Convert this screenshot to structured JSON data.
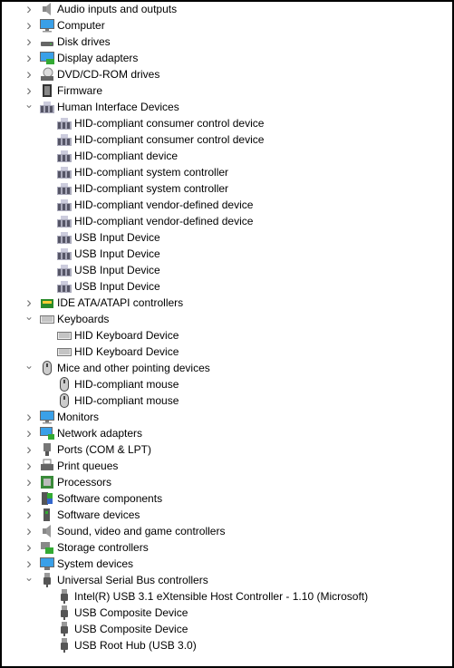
{
  "tree": [
    {
      "label": "Audio inputs and outputs",
      "level": 1,
      "expanded": false,
      "icon": "speaker-icon"
    },
    {
      "label": "Computer",
      "level": 1,
      "expanded": false,
      "icon": "monitor-icon"
    },
    {
      "label": "Disk drives",
      "level": 1,
      "expanded": false,
      "icon": "disk-drive-icon"
    },
    {
      "label": "Display adapters",
      "level": 1,
      "expanded": false,
      "icon": "display-adapter-icon"
    },
    {
      "label": "DVD/CD-ROM drives",
      "level": 1,
      "expanded": false,
      "icon": "dvd-drive-icon"
    },
    {
      "label": "Firmware",
      "level": 1,
      "expanded": false,
      "icon": "chip-icon"
    },
    {
      "label": "Human Interface Devices",
      "level": 1,
      "expanded": true,
      "icon": "hid-icon"
    },
    {
      "label": "HID-compliant consumer control device",
      "level": 2,
      "icon": "hid-icon"
    },
    {
      "label": "HID-compliant consumer control device",
      "level": 2,
      "icon": "hid-icon"
    },
    {
      "label": "HID-compliant device",
      "level": 2,
      "icon": "hid-icon"
    },
    {
      "label": "HID-compliant system controller",
      "level": 2,
      "icon": "hid-icon"
    },
    {
      "label": "HID-compliant system controller",
      "level": 2,
      "icon": "hid-icon"
    },
    {
      "label": "HID-compliant vendor-defined device",
      "level": 2,
      "icon": "hid-icon"
    },
    {
      "label": "HID-compliant vendor-defined device",
      "level": 2,
      "icon": "hid-icon"
    },
    {
      "label": "USB Input Device",
      "level": 2,
      "icon": "hid-icon"
    },
    {
      "label": "USB Input Device",
      "level": 2,
      "icon": "hid-icon"
    },
    {
      "label": "USB Input Device",
      "level": 2,
      "icon": "hid-icon"
    },
    {
      "label": "USB Input Device",
      "level": 2,
      "icon": "hid-icon"
    },
    {
      "label": "IDE ATA/ATAPI controllers",
      "level": 1,
      "expanded": false,
      "icon": "ide-controller-icon"
    },
    {
      "label": "Keyboards",
      "level": 1,
      "expanded": true,
      "icon": "keyboard-icon"
    },
    {
      "label": "HID Keyboard Device",
      "level": 2,
      "icon": "keyboard-icon"
    },
    {
      "label": "HID Keyboard Device",
      "level": 2,
      "icon": "keyboard-icon"
    },
    {
      "label": "Mice and other pointing devices",
      "level": 1,
      "expanded": true,
      "icon": "mouse-icon"
    },
    {
      "label": "HID-compliant mouse",
      "level": 2,
      "icon": "mouse-icon"
    },
    {
      "label": "HID-compliant mouse",
      "level": 2,
      "icon": "mouse-icon"
    },
    {
      "label": "Monitors",
      "level": 1,
      "expanded": false,
      "icon": "monitor-icon"
    },
    {
      "label": "Network adapters",
      "level": 1,
      "expanded": false,
      "icon": "network-adapter-icon"
    },
    {
      "label": "Ports (COM & LPT)",
      "level": 1,
      "expanded": false,
      "icon": "port-icon"
    },
    {
      "label": "Print queues",
      "level": 1,
      "expanded": false,
      "icon": "printer-icon"
    },
    {
      "label": "Processors",
      "level": 1,
      "expanded": false,
      "icon": "processor-icon"
    },
    {
      "label": "Software components",
      "level": 1,
      "expanded": false,
      "icon": "software-component-icon"
    },
    {
      "label": "Software devices",
      "level": 1,
      "expanded": false,
      "icon": "software-device-icon"
    },
    {
      "label": "Sound, video and game controllers",
      "level": 1,
      "expanded": false,
      "icon": "speaker-icon"
    },
    {
      "label": "Storage controllers",
      "level": 1,
      "expanded": false,
      "icon": "storage-controller-icon"
    },
    {
      "label": "System devices",
      "level": 1,
      "expanded": false,
      "icon": "system-device-icon"
    },
    {
      "label": "Universal Serial Bus controllers",
      "level": 1,
      "expanded": true,
      "icon": "usb-icon"
    },
    {
      "label": "Intel(R) USB 3.1 eXtensible Host Controller - 1.10 (Microsoft)",
      "level": 2,
      "icon": "usb-icon"
    },
    {
      "label": "USB Composite Device",
      "level": 2,
      "icon": "usb-icon"
    },
    {
      "label": "USB Composite Device",
      "level": 2,
      "icon": "usb-icon"
    },
    {
      "label": "USB Root Hub (USB 3.0)",
      "level": 2,
      "icon": "usb-icon"
    }
  ]
}
